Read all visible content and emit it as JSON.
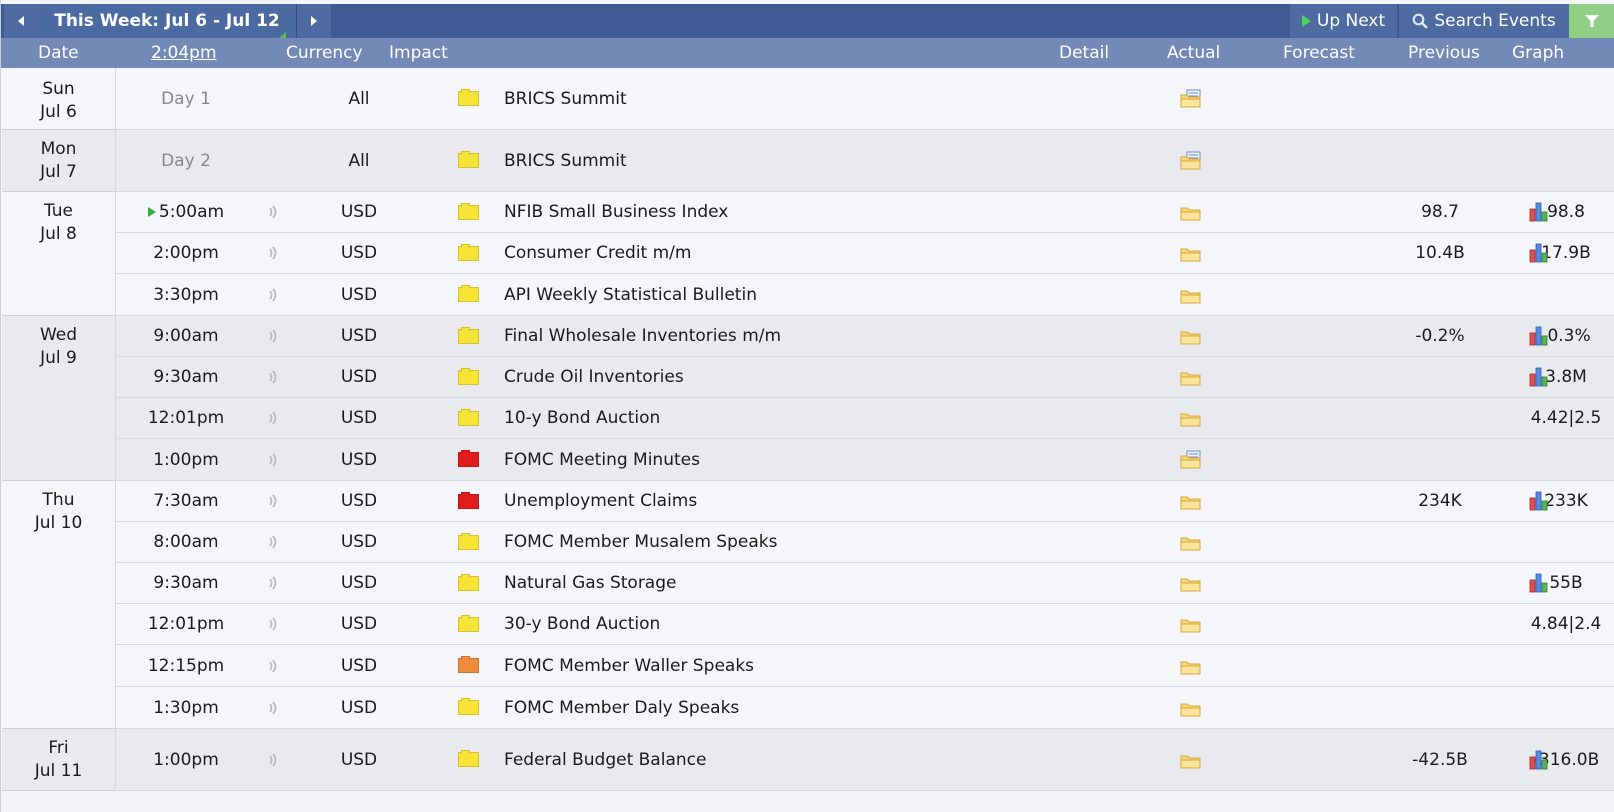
{
  "toolbar": {
    "week_label": "This Week: Jul 6 - Jul 12",
    "up_next": "Up Next",
    "search_events": "Search Events"
  },
  "columns": {
    "date": "Date",
    "time": "2:04pm",
    "currency": "Currency",
    "impact": "Impact",
    "detail": "Detail",
    "actual": "Actual",
    "forecast": "Forecast",
    "previous": "Previous",
    "graph": "Graph"
  },
  "colors": {
    "yellow": "#f7e437",
    "red": "#e11c1c",
    "orange": "#f08b3a"
  },
  "days": [
    {
      "day": "Sun",
      "date": "Jul 6"
    },
    {
      "day": "Mon",
      "date": "Jul 7"
    },
    {
      "day": "Tue",
      "date": "Jul 8"
    },
    {
      "day": "Wed",
      "date": "Jul 9"
    },
    {
      "day": "Thu",
      "date": "Jul 10"
    },
    {
      "day": "Fri",
      "date": "Jul 11"
    }
  ],
  "events": [
    {
      "time": "Day 1",
      "currency": "All",
      "impact": "yellow",
      "event": "BRICS Summit",
      "forecast": "",
      "previous": ""
    },
    {
      "time": "Day 2",
      "currency": "All",
      "impact": "yellow",
      "event": "BRICS Summit",
      "forecast": "",
      "previous": ""
    },
    {
      "time": "5:00am",
      "currency": "USD",
      "impact": "yellow",
      "event": "NFIB Small Business Index",
      "forecast": "98.7",
      "previous": "98.8"
    },
    {
      "time": "2:00pm",
      "currency": "USD",
      "impact": "yellow",
      "event": "Consumer Credit m/m",
      "forecast": "10.4B",
      "previous": "17.9B"
    },
    {
      "time": "3:30pm",
      "currency": "USD",
      "impact": "yellow",
      "event": "API Weekly Statistical Bulletin",
      "forecast": "",
      "previous": ""
    },
    {
      "time": "9:00am",
      "currency": "USD",
      "impact": "yellow",
      "event": "Final Wholesale Inventories m/m",
      "forecast": "-0.2%",
      "previous": "-0.3%"
    },
    {
      "time": "9:30am",
      "currency": "USD",
      "impact": "yellow",
      "event": "Crude Oil Inventories",
      "forecast": "",
      "previous": "3.8M"
    },
    {
      "time": "12:01pm",
      "currency": "USD",
      "impact": "yellow",
      "event": "10-y Bond Auction",
      "forecast": "",
      "previous": "4.42|2.5"
    },
    {
      "time": "1:00pm",
      "currency": "USD",
      "impact": "red",
      "event": "FOMC Meeting Minutes",
      "forecast": "",
      "previous": ""
    },
    {
      "time": "7:30am",
      "currency": "USD",
      "impact": "red",
      "event": "Unemployment Claims",
      "forecast": "234K",
      "previous": "233K"
    },
    {
      "time": "8:00am",
      "currency": "USD",
      "impact": "yellow",
      "event": "FOMC Member Musalem Speaks",
      "forecast": "",
      "previous": ""
    },
    {
      "time": "9:30am",
      "currency": "USD",
      "impact": "yellow",
      "event": "Natural Gas Storage",
      "forecast": "",
      "previous": "55B"
    },
    {
      "time": "12:01pm",
      "currency": "USD",
      "impact": "yellow",
      "event": "30-y Bond Auction",
      "forecast": "",
      "previous": "4.84|2.4"
    },
    {
      "time": "12:15pm",
      "currency": "USD",
      "impact": "orange",
      "event": "FOMC Member Waller Speaks",
      "forecast": "",
      "previous": ""
    },
    {
      "time": "1:30pm",
      "currency": "USD",
      "impact": "yellow",
      "event": "FOMC Member Daly Speaks",
      "forecast": "",
      "previous": ""
    },
    {
      "time": "1:00pm",
      "currency": "USD",
      "impact": "yellow",
      "event": "Federal Budget Balance",
      "forecast": "-42.5B",
      "previous": "-316.0B"
    }
  ]
}
